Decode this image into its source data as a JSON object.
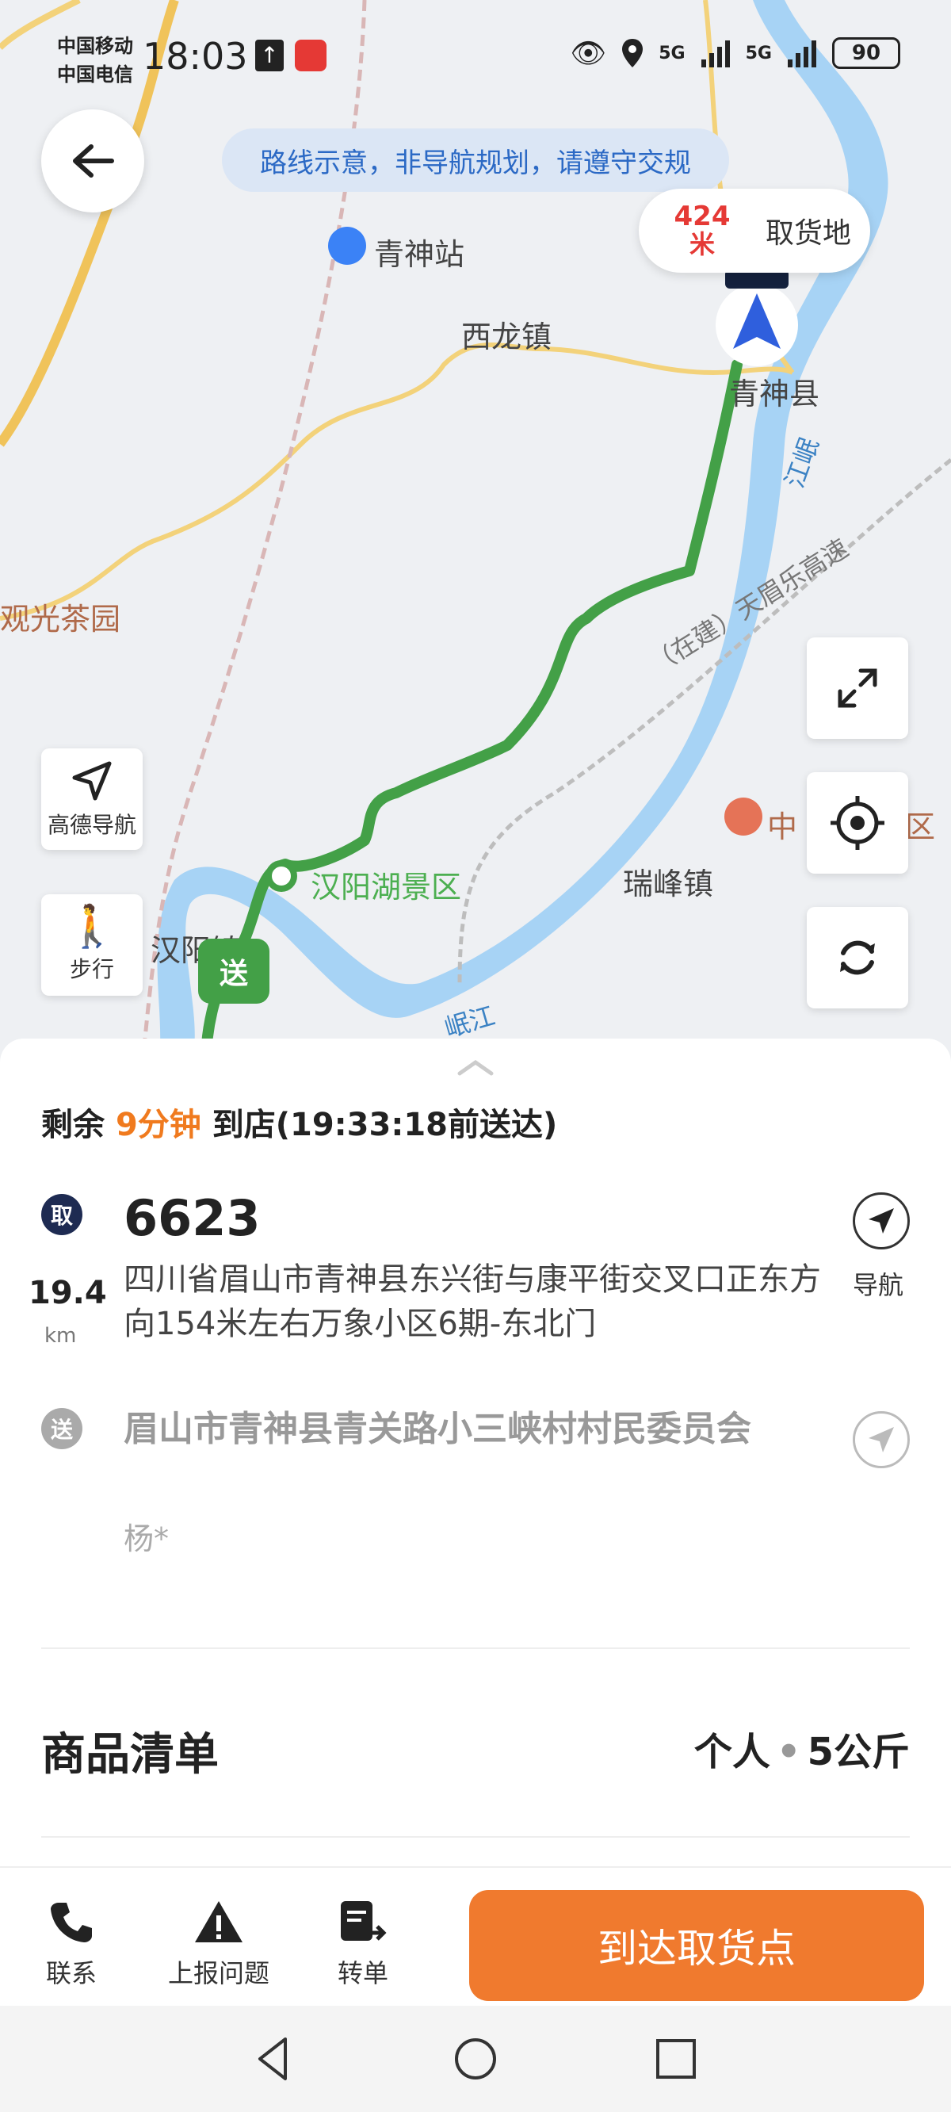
{
  "status_bar": {
    "carrier1": "中国移动",
    "carrier2": "中国电信",
    "time": "18:03",
    "signal1": "5G",
    "signal2": "5G",
    "battery": "90"
  },
  "map": {
    "notice": "路线示意，非导航规划，请遵守交规",
    "distance_value": "424",
    "distance_unit": "米",
    "distance_label": "取货地",
    "labels": {
      "station": "青神站",
      "xilong": "西龙镇",
      "qingshen": "青神县",
      "tea_garden": "观光茶园",
      "hanyang_lake": "汉阳湖景区",
      "hanyang_town": "汉阳镇",
      "ruifeng": "瑞峰镇",
      "minjiang": "岷江",
      "minjiang2": "江岷",
      "highway": "（在建）天眉乐高速",
      "poi_middle": "中",
      "poi_right": "区"
    },
    "gaode_nav_label": "高德导航",
    "walk_label": "步行",
    "send_marker": "送"
  },
  "order": {
    "remain_prefix": "剩余",
    "remain_time": "9分钟",
    "remain_suffix": "到店(19:33:18前送达)",
    "pick_badge": "取",
    "pick_code": "6623",
    "pick_address": "四川省眉山市青神县东兴街与康平街交叉口正东方向154米左右万象小区6期-东北门",
    "distance_km": "19.4",
    "distance_unit": "km",
    "nav_label": "导航",
    "drop_badge": "送",
    "drop_address": "眉山市青神县青关路小三峡村村民委员会",
    "drop_name": "杨*",
    "goods_title": "商品清单",
    "goods_type": "个人",
    "goods_weight": "5公斤"
  },
  "actions": {
    "contact": "联系",
    "report": "上报问题",
    "transfer": "转单",
    "arrive": "到达取货点"
  },
  "colors": {
    "route_green": "#43a047",
    "accent_orange": "#f07a2e",
    "river_blue": "#a7d3f5",
    "road_yellow": "#f3d27a"
  }
}
